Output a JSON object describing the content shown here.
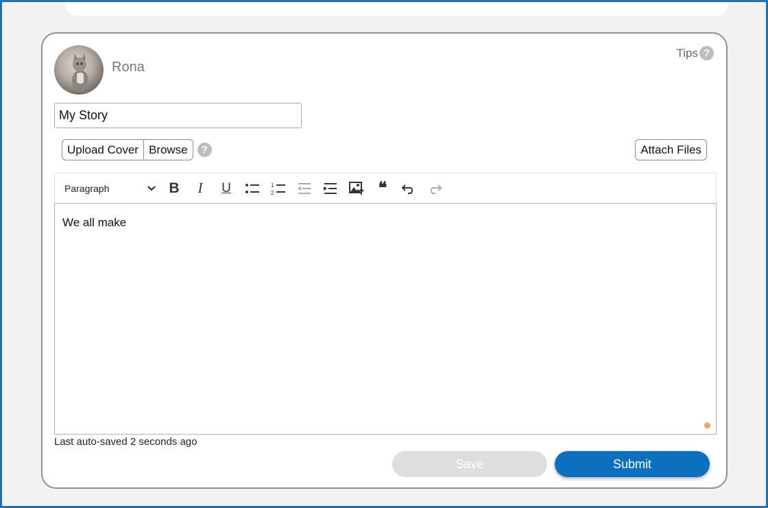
{
  "profile": {
    "name": "Rona",
    "avatar_icon": "cat-avatar"
  },
  "tips": {
    "label": "Tips"
  },
  "story": {
    "title_value": "My Story"
  },
  "cover": {
    "upload_label": "Upload Cover",
    "browse_label": "Browse"
  },
  "attach": {
    "label": "Attach Files"
  },
  "toolbar": {
    "block_style": "Paragraph",
    "icons": [
      "bold-icon",
      "italic-icon",
      "underline-icon",
      "bullet-list-icon",
      "numbered-list-icon",
      "outdent-icon",
      "indent-icon",
      "insert-image-icon",
      "blockquote-icon",
      "undo-icon",
      "redo-icon"
    ]
  },
  "editor": {
    "content": "We all make"
  },
  "status": {
    "autosave_text": "Last auto-saved 2 seconds ago"
  },
  "actions": {
    "save_label": "Save",
    "submit_label": "Submit"
  },
  "colors": {
    "accent": "#0d6fbf",
    "frame": "#1f6fb2",
    "disabled": "#dedede",
    "indicator": "#f0a05a"
  }
}
